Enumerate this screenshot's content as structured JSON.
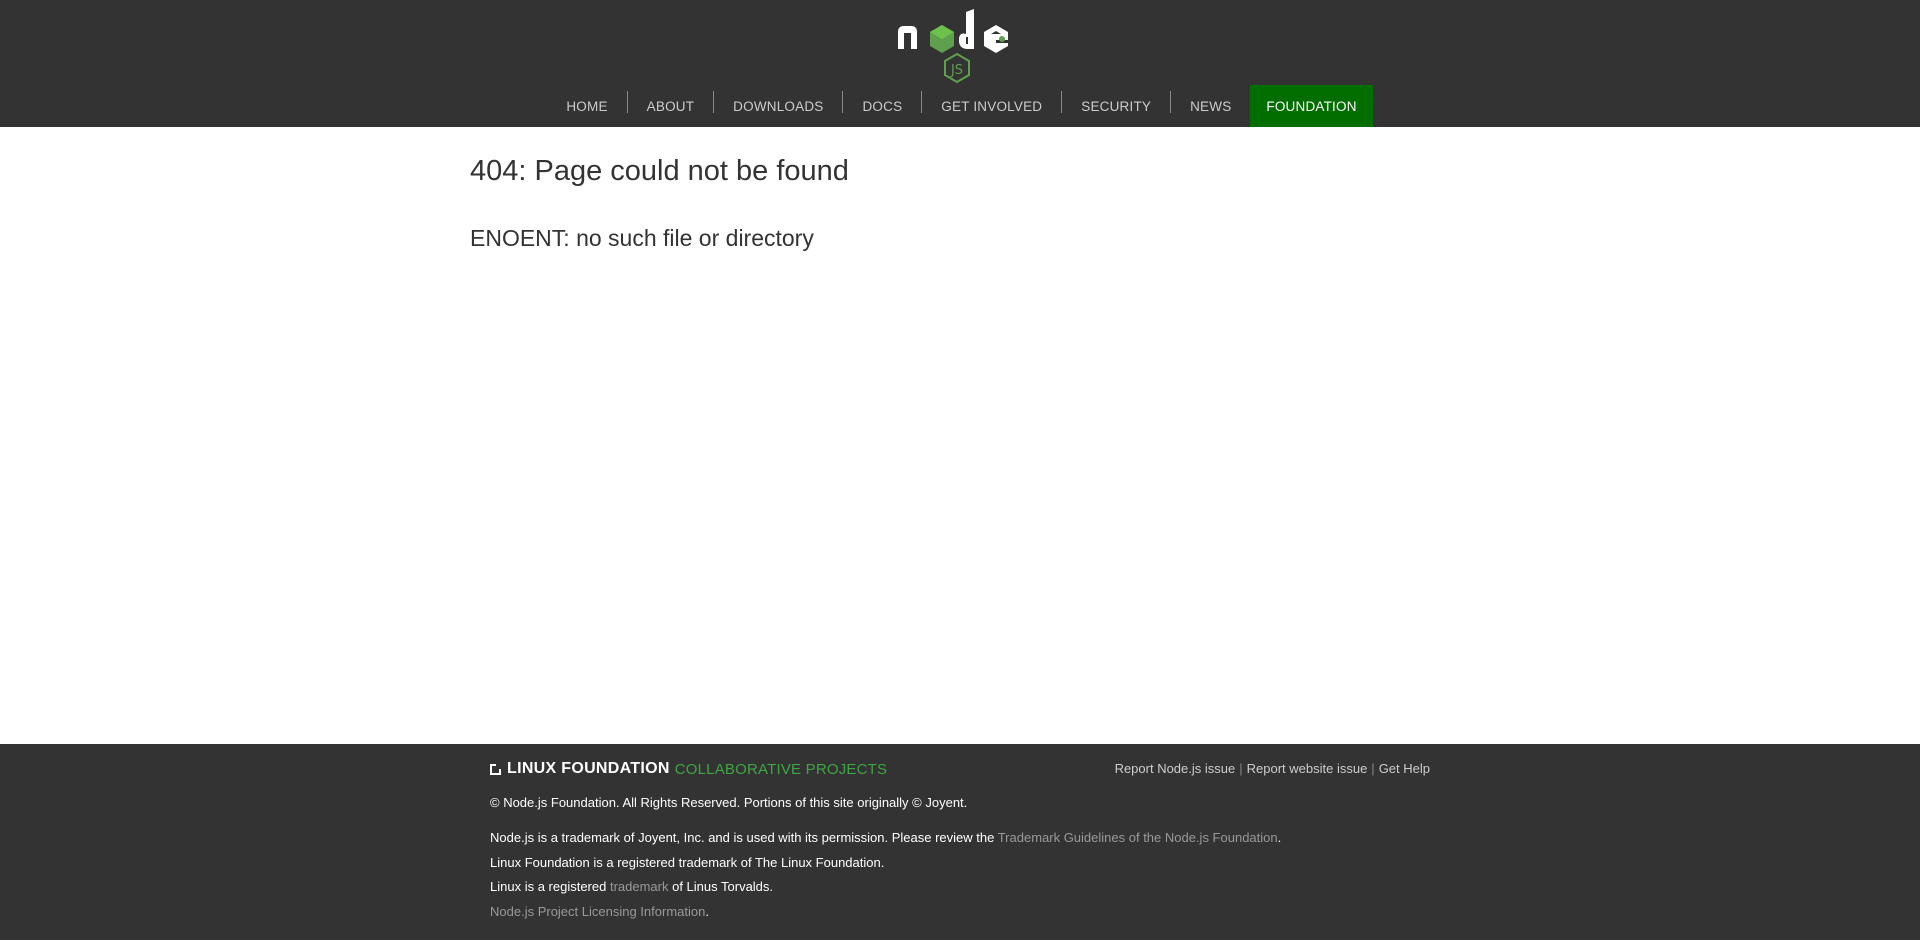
{
  "header": {
    "logo_alt": "node js",
    "nav": [
      {
        "label": "HOME",
        "active": false
      },
      {
        "label": "ABOUT",
        "active": false
      },
      {
        "label": "DOWNLOADS",
        "active": false
      },
      {
        "label": "DOCS",
        "active": false
      },
      {
        "label": "GET INVOLVED",
        "active": false
      },
      {
        "label": "SECURITY",
        "active": false
      },
      {
        "label": "NEWS",
        "active": false
      },
      {
        "label": "FOUNDATION",
        "active": true
      }
    ]
  },
  "main": {
    "title": "404: Page could not be found",
    "error": "ENOENT: no such file or directory"
  },
  "footer": {
    "lf_bold": "LINUX FOUNDATION",
    "lf_light": "COLLABORATIVE PROJECTS",
    "links": [
      "Report Node.js issue",
      "Report website issue",
      "Get Help"
    ],
    "link_separator": "|",
    "copyright": "© Node.js Foundation. All Rights Reserved. Portions of this site originally © Joyent.",
    "trademark_pre": "Node.js is a trademark of Joyent, Inc. and is used with its permission. Please review the ",
    "trademark_link": "Trademark Guidelines of the Node.js Foundation",
    "trademark_post": ".",
    "lf_trademark": "Linux Foundation is a registered trademark of The Linux Foundation.",
    "linux_pre": "Linux is a registered ",
    "linux_link": "trademark",
    "linux_post": " of Linus Torvalds.",
    "licensing_link": "Node.js Project Licensing Information",
    "licensing_post": "."
  },
  "colors": {
    "header_bg": "#333333",
    "accent_green": "#026e00",
    "logo_green": "#3fa544"
  }
}
